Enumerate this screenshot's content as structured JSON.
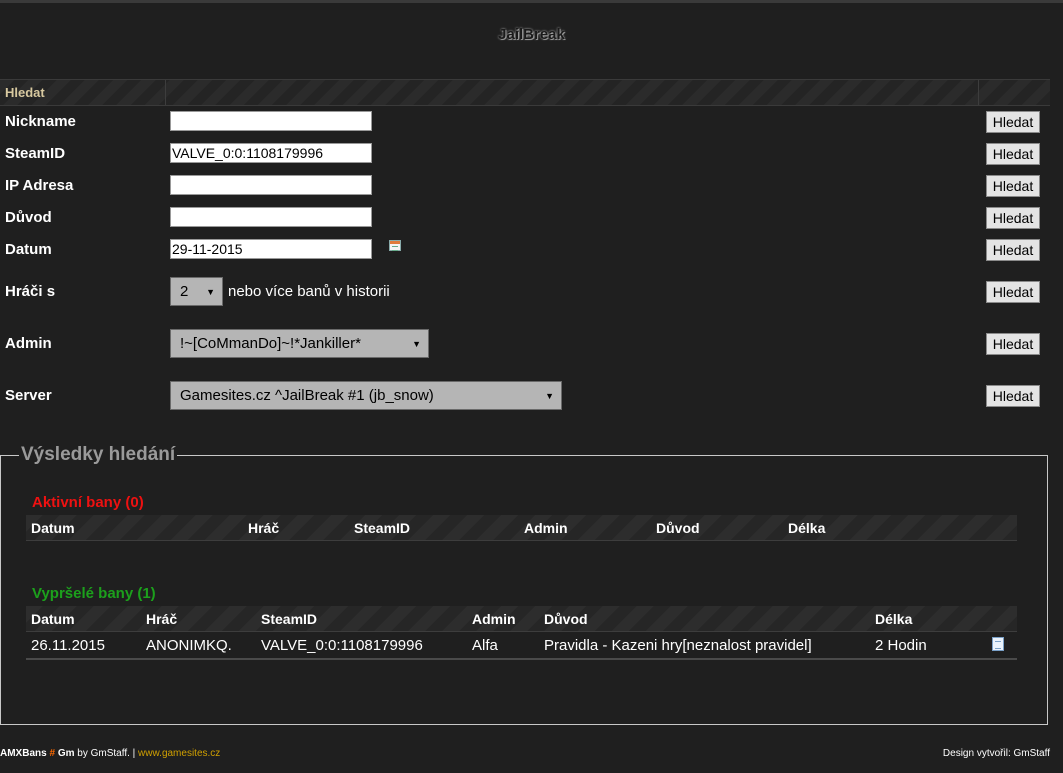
{
  "page": {
    "title": "JailBreak"
  },
  "search": {
    "section_label": "Hledat",
    "nickname": {
      "label": "Nickname",
      "value": "",
      "button": "Hledat"
    },
    "steamid": {
      "label": "SteamID",
      "value": "VALVE_0:0:1108179996",
      "button": "Hledat"
    },
    "ip": {
      "label": "IP Adresa",
      "value": "",
      "button": "Hledat"
    },
    "reason": {
      "label": "Důvod",
      "value": "",
      "button": "Hledat"
    },
    "date": {
      "label": "Datum",
      "value": "29-11-2015",
      "button": "Hledat",
      "icon": "calendar-icon"
    },
    "players": {
      "label": "Hráči s",
      "selected": "2",
      "suffix": "nebo více banů v historii",
      "button": "Hledat"
    },
    "admin": {
      "label": "Admin",
      "selected": "!~[CoMmanDo]~!*Jankiller*",
      "button": "Hledat"
    },
    "server": {
      "label": "Server",
      "selected": "Gamesites.cz ^JailBreak #1 (jb_snow)",
      "button": "Hledat"
    }
  },
  "results": {
    "legend": "Výsledky hledání",
    "active": {
      "heading": "Aktivní bany (0)",
      "columns": [
        "Datum",
        "Hráč",
        "SteamID",
        "Admin",
        "Důvod",
        "Délka"
      ]
    },
    "expired": {
      "heading": "Vypršelé bany (1)",
      "columns": [
        "Datum",
        "Hráč",
        "SteamID",
        "Admin",
        "Důvod",
        "Délka"
      ],
      "rows": [
        {
          "date": "26.11.2015",
          "player": "ANONIMKQ.",
          "steamid": "VALVE_0:0:1108179996",
          "admin": "Alfa",
          "reason": "Pravidla - Kazeni hry[neznalost pravidel]",
          "length": "2 Hodin",
          "icon": "document-icon"
        }
      ]
    }
  },
  "footer": {
    "brand": "AMXBans",
    "sep": "#",
    "gm": "Gm",
    "by": "by GmStaff. |",
    "link": "www.gamesites.cz",
    "design": "Design vytvořil: GmStaff"
  },
  "colors": {
    "active_heading": "#ee1111",
    "expired_heading": "#1ca01c",
    "section_label": "#d8c9a0",
    "background": "#1f1f1f"
  }
}
